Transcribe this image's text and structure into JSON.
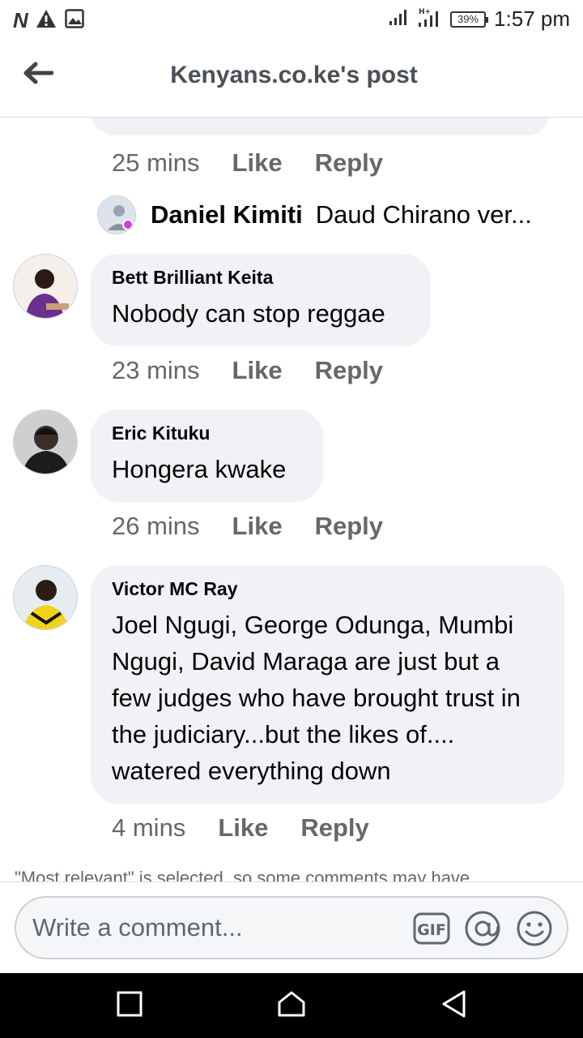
{
  "status_bar": {
    "carrier_icon": "N",
    "battery": "39%",
    "time": "1:57 pm"
  },
  "header": {
    "title": "Kenyans.co.ke's post"
  },
  "previous": {
    "time": "25 mins",
    "like": "Like",
    "reply": "Reply",
    "reply_preview": {
      "name": "Daniel Kimiti",
      "text": "Daud Chirano ver..."
    }
  },
  "comments": [
    {
      "name": "Bett Brilliant Keita",
      "text": "Nobody can stop reggae",
      "time": "23 mins",
      "like": "Like",
      "reply": "Reply"
    },
    {
      "name": "Eric Kituku",
      "text": "Hongera kwake",
      "time": "26 mins",
      "like": "Like",
      "reply": "Reply"
    },
    {
      "name": "Victor MC Ray",
      "text": "Joel Ngugi, George Odunga, Mumbi Ngugi, David Maraga are just but a few judges who have brought trust in the judiciary...but the likes of.... watered everything down",
      "time": "4 mins",
      "like": "Like",
      "reply": "Reply"
    }
  ],
  "footer_note": "\"Most relevant\" is selected, so some comments may have",
  "composer": {
    "placeholder": "Write a comment..."
  },
  "icons": {
    "back": "arrow-left-icon",
    "gif": "gif-icon",
    "mention": "at-icon",
    "emoji": "smiley-icon"
  }
}
